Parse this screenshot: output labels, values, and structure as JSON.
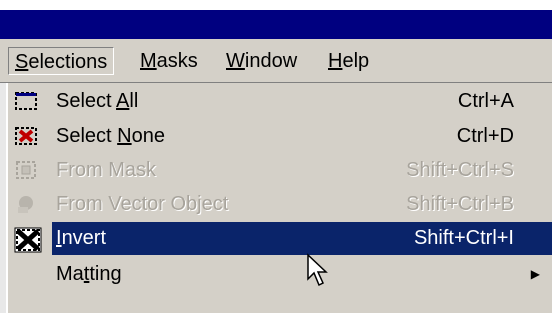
{
  "menubar": {
    "items": [
      {
        "label": "Selections",
        "underline": "S"
      },
      {
        "label": "Masks",
        "underline": "M"
      },
      {
        "label": "Window",
        "underline": "W"
      },
      {
        "label": "Help",
        "underline": "H"
      }
    ]
  },
  "menu": {
    "items": [
      {
        "label_pre": "Select ",
        "label_u": "A",
        "label_post": "ll",
        "shortcut": "Ctrl+A",
        "icon": "select-all-icon",
        "state": "enabled"
      },
      {
        "label_pre": "Select ",
        "label_u": "N",
        "label_post": "one",
        "shortcut": "Ctrl+D",
        "icon": "select-none-icon",
        "state": "enabled"
      },
      {
        "label_pre": "From Mask",
        "label_u": "",
        "label_post": "",
        "shortcut": "Shift+Ctrl+S",
        "icon": "from-mask-icon",
        "state": "disabled"
      },
      {
        "label_pre": "From Vector Object",
        "label_u": "",
        "label_post": "",
        "shortcut": "Shift+Ctrl+B",
        "icon": "from-vector-object-icon",
        "state": "disabled"
      },
      {
        "label_pre": "",
        "label_u": "I",
        "label_post": "nvert",
        "shortcut": "Shift+Ctrl+I",
        "icon": "invert-icon",
        "state": "highlighted"
      },
      {
        "label_pre": "Ma",
        "label_u": "t",
        "label_post": "ting",
        "shortcut": "",
        "icon": "",
        "state": "submenu"
      }
    ]
  },
  "colors": {
    "titlebar": "#000080",
    "face": "#d4d0c8",
    "highlight": "#0a246a",
    "disabled_text": "#a8a49c"
  }
}
